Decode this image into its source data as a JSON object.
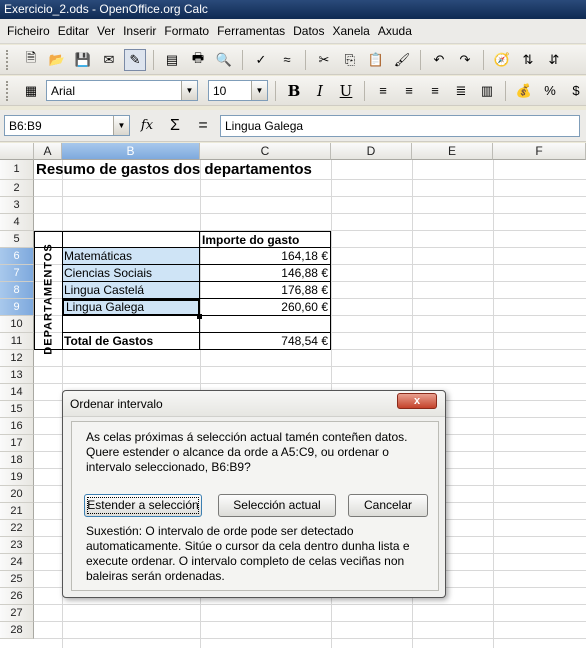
{
  "window": {
    "title": "Exercicio_2.ods - OpenOffice.org Calc"
  },
  "menu": [
    {
      "label": "Ficheiro"
    },
    {
      "label": "Editar"
    },
    {
      "label": "Ver"
    },
    {
      "label": "Inserir"
    },
    {
      "label": "Formato"
    },
    {
      "label": "Ferramentas"
    },
    {
      "label": "Datos"
    },
    {
      "label": "Xanela"
    },
    {
      "label": "Axuda"
    }
  ],
  "format_bar": {
    "font_name": "Arial",
    "font_size": "10"
  },
  "formula_bar": {
    "name_box": "B6:B9",
    "content": "Lingua Galega"
  },
  "columns": [
    "A",
    "B",
    "C",
    "D",
    "E",
    "F"
  ],
  "rows": [
    "1",
    "2",
    "3",
    "4",
    "5",
    "6",
    "7",
    "8",
    "9",
    "10",
    "11",
    "12",
    "13",
    "14",
    "15",
    "16",
    "17",
    "18",
    "19",
    "20",
    "21",
    "22",
    "23",
    "24",
    "25",
    "26",
    "27",
    "28"
  ],
  "sheet": {
    "title": "Resumo de gastos dos departamentos",
    "header_amount": "Importe do gasto",
    "vertical_label": "DEPARTAMENTOS",
    "departments": [
      {
        "name": "Matemáticas",
        "amount": "164,18 €"
      },
      {
        "name": "Ciencias Sociais",
        "amount": "146,88 €"
      },
      {
        "name": "Lingua Castelá",
        "amount": "176,88 €"
      },
      {
        "name": "Lingua Galega",
        "amount": "260,60 €"
      }
    ],
    "total_label": "Total de Gastos",
    "total_amount": "748,54 €"
  },
  "dialog": {
    "title": "Ordenar intervalo",
    "close_label": "x",
    "message": "As celas próximas á selección actual tamén conteñen datos. Quere estender o alcance da orde a A5:C9, ou ordenar o intervalo seleccionado, B6:B9?",
    "btn_extend": "Estender a selección",
    "btn_current": "Selección actual",
    "btn_cancel": "Cancelar",
    "hint": "Suxestión: O intervalo de orde pode ser detectado automaticamente. Sitúe o cursor da cela dentro dunha lista e execute ordenar. O intervalo completo de celas veciñas non baleiras serán ordenadas."
  }
}
